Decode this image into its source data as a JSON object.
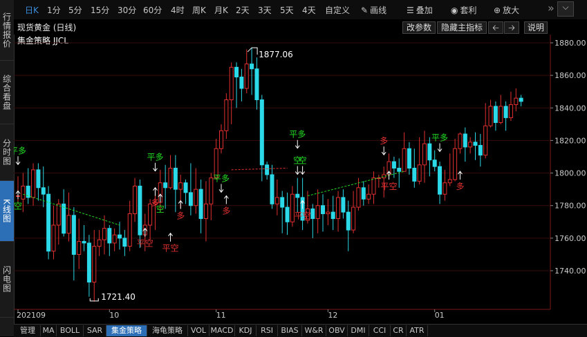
{
  "sidebar": {
    "items": [
      {
        "label": "行情报价",
        "active": false
      },
      {
        "label": "综合看盘",
        "active": false
      },
      {
        "label": "分时图",
        "active": false
      },
      {
        "label": "K线图",
        "active": true
      },
      {
        "label": "闪电图",
        "active": false
      }
    ]
  },
  "toolbar": {
    "periods": [
      "日K",
      "1分",
      "5分",
      "15分",
      "30分",
      "60分",
      "4时",
      "周K",
      "月K",
      "2天",
      "3天",
      "5天",
      "4天",
      "自定义"
    ],
    "active_period": "日K",
    "draw_label": "画线",
    "overlay_label": "叠加",
    "arbitrage_label": "套利",
    "zoom_label": "放大"
  },
  "subheader": {
    "instrument": "现货黄金 (日线)",
    "modify_params": "改参数",
    "hide_main": "隐藏主指标",
    "prev_icon": "left-arrow-icon",
    "next_icon": "right-arrow-icon",
    "help": "说明"
  },
  "indicator_title": "集金策略 JJCL",
  "chart_data": {
    "type": "candlestick",
    "y_ticks": [
      "1880.00",
      "1860.00",
      "1840.00",
      "1820.00",
      "1800.00",
      "1780.00",
      "1760.00",
      "1740.00"
    ],
    "ylim": [
      1720,
      1885
    ],
    "x_labels": [
      "202109",
      "10",
      "11",
      "12",
      "01"
    ],
    "high_label": "1877.06",
    "low_label": "1721.40",
    "signals": [
      "平多",
      "多",
      "空",
      "平空"
    ],
    "colors": {
      "up": "#e23030",
      "down": "#2bd9e8",
      "grid": "#5a1010",
      "axis": "#888888"
    },
    "candles": [
      [
        1786,
        1786,
        1781,
        1798
      ],
      [
        1784,
        1792,
        1776,
        1800
      ],
      [
        1792,
        1785,
        1781,
        1803
      ],
      [
        1785,
        1802,
        1780,
        1806
      ],
      [
        1802,
        1791,
        1783,
        1806
      ],
      [
        1791,
        1787,
        1779,
        1804
      ],
      [
        1787,
        1752,
        1747,
        1792
      ],
      [
        1752,
        1768,
        1747,
        1780
      ],
      [
        1768,
        1781,
        1756,
        1784
      ],
      [
        1781,
        1763,
        1761,
        1790
      ],
      [
        1763,
        1774,
        1758,
        1788
      ],
      [
        1774,
        1750,
        1734,
        1779
      ],
      [
        1750,
        1758,
        1741,
        1772
      ],
      [
        1758,
        1757,
        1752,
        1768
      ],
      [
        1757,
        1733,
        1724,
        1762
      ],
      [
        1733,
        1755,
        1721,
        1765
      ],
      [
        1755,
        1759,
        1749,
        1765
      ],
      [
        1759,
        1766,
        1750,
        1774
      ],
      [
        1766,
        1757,
        1749,
        1768
      ],
      [
        1757,
        1762,
        1752,
        1766
      ],
      [
        1762,
        1760,
        1753,
        1770
      ],
      [
        1760,
        1755,
        1749,
        1765
      ],
      [
        1755,
        1775,
        1752,
        1783
      ],
      [
        1775,
        1792,
        1770,
        1797
      ],
      [
        1792,
        1762,
        1754,
        1796
      ],
      [
        1762,
        1768,
        1752,
        1775
      ],
      [
        1768,
        1781,
        1759,
        1784
      ],
      [
        1781,
        1782,
        1765,
        1790
      ],
      [
        1782,
        1794,
        1776,
        1802
      ],
      [
        1794,
        1791,
        1778,
        1805
      ],
      [
        1791,
        1803,
        1790,
        1811
      ],
      [
        1803,
        1790,
        1776,
        1811
      ],
      [
        1790,
        1794,
        1778,
        1799
      ],
      [
        1794,
        1788,
        1781,
        1796
      ],
      [
        1788,
        1780,
        1774,
        1806
      ],
      [
        1780,
        1790,
        1775,
        1803
      ],
      [
        1790,
        1772,
        1763,
        1796
      ],
      [
        1772,
        1781,
        1758,
        1795
      ],
      [
        1781,
        1797,
        1771,
        1800
      ],
      [
        1797,
        1815,
        1796,
        1821
      ],
      [
        1815,
        1826,
        1812,
        1830
      ],
      [
        1826,
        1845,
        1821,
        1849
      ],
      [
        1845,
        1865,
        1830,
        1868
      ],
      [
        1865,
        1859,
        1840,
        1868
      ],
      [
        1859,
        1852,
        1844,
        1864
      ],
      [
        1852,
        1867,
        1849,
        1876
      ],
      [
        1867,
        1864,
        1848,
        1877
      ],
      [
        1864,
        1845,
        1839,
        1871
      ],
      [
        1845,
        1805,
        1795,
        1848
      ],
      [
        1805,
        1799,
        1796,
        1807
      ],
      [
        1799,
        1781,
        1778,
        1805
      ],
      [
        1781,
        1785,
        1774,
        1796
      ],
      [
        1785,
        1779,
        1763,
        1789
      ],
      [
        1779,
        1770,
        1762,
        1788
      ],
      [
        1770,
        1787,
        1767,
        1792
      ],
      [
        1787,
        1785,
        1776,
        1797
      ],
      [
        1785,
        1771,
        1765,
        1797
      ],
      [
        1771,
        1778,
        1769,
        1789
      ],
      [
        1778,
        1772,
        1760,
        1781
      ],
      [
        1772,
        1780,
        1763,
        1790
      ],
      [
        1780,
        1775,
        1764,
        1787
      ],
      [
        1775,
        1776,
        1768,
        1784
      ],
      [
        1776,
        1772,
        1765,
        1786
      ],
      [
        1772,
        1785,
        1764,
        1789
      ],
      [
        1785,
        1776,
        1772,
        1790
      ],
      [
        1776,
        1765,
        1752,
        1783
      ],
      [
        1765,
        1779,
        1763,
        1789
      ],
      [
        1779,
        1791,
        1777,
        1797
      ],
      [
        1791,
        1784,
        1780,
        1795
      ],
      [
        1784,
        1787,
        1781,
        1793
      ],
      [
        1787,
        1797,
        1781,
        1801
      ],
      [
        1797,
        1797,
        1791,
        1799
      ],
      [
        1797,
        1799,
        1785,
        1804
      ],
      [
        1799,
        1807,
        1797,
        1812
      ],
      [
        1807,
        1803,
        1797,
        1810
      ],
      [
        1803,
        1801,
        1791,
        1809
      ],
      [
        1801,
        1815,
        1801,
        1825
      ],
      [
        1815,
        1803,
        1799,
        1819
      ],
      [
        1803,
        1795,
        1791,
        1815
      ],
      [
        1795,
        1805,
        1793,
        1822
      ],
      [
        1805,
        1818,
        1794,
        1826
      ],
      [
        1818,
        1808,
        1798,
        1822
      ],
      [
        1808,
        1804,
        1801,
        1814
      ],
      [
        1804,
        1787,
        1781,
        1807
      ],
      [
        1787,
        1794,
        1783,
        1802
      ],
      [
        1794,
        1796,
        1792,
        1812
      ],
      [
        1796,
        1815,
        1795,
        1821
      ],
      [
        1815,
        1824,
        1812,
        1825
      ],
      [
        1824,
        1816,
        1807,
        1828
      ],
      [
        1816,
        1819,
        1812,
        1822
      ],
      [
        1819,
        1817,
        1808,
        1825
      ],
      [
        1817,
        1811,
        1804,
        1824
      ],
      [
        1811,
        1829,
        1809,
        1843
      ],
      [
        1829,
        1841,
        1828,
        1845
      ],
      [
        1841,
        1831,
        1826,
        1844
      ],
      [
        1831,
        1841,
        1830,
        1848
      ],
      [
        1841,
        1834,
        1826,
        1844
      ],
      [
        1834,
        1842,
        1832,
        1850
      ],
      [
        1842,
        1846,
        1838,
        1852
      ],
      [
        1846,
        1844,
        1841,
        1848
      ]
    ]
  }
}
